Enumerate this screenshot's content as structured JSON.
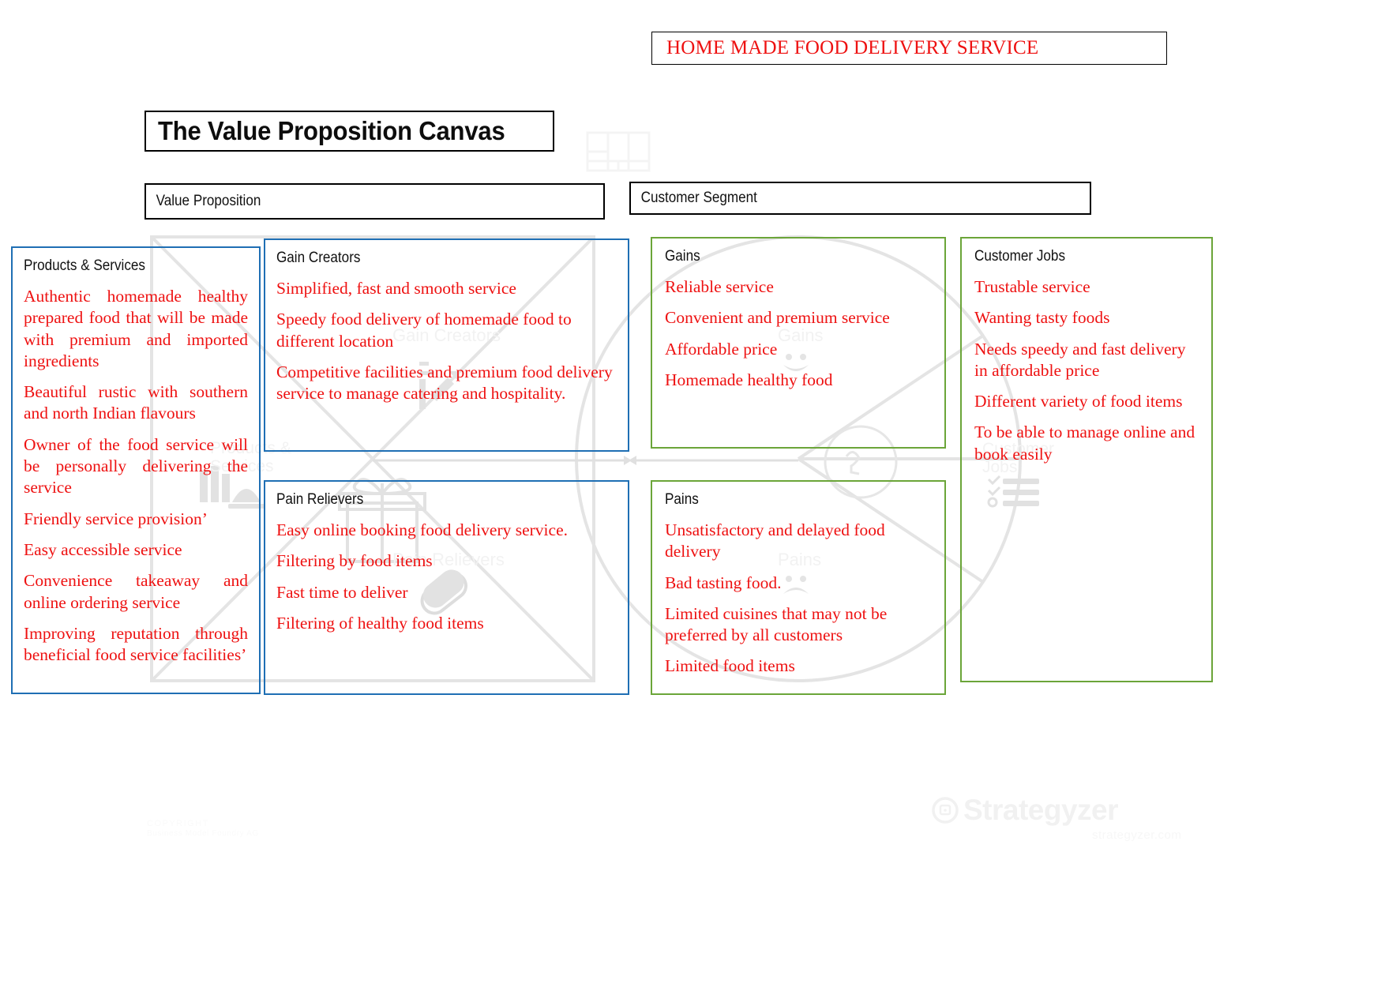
{
  "document": {
    "title": "HOME MADE FOOD DELIVERY SERVICE",
    "canvas_title": "The Value Proposition Canvas"
  },
  "colors": {
    "text_red": "#ee1111",
    "value_prop_border": "#1f6fb4",
    "customer_border": "#6ba539",
    "header_border": "#000000",
    "watermark": "#f2f2f2"
  },
  "sections": {
    "value_proposition": {
      "label": "Value Proposition"
    },
    "customer_segment": {
      "label": "Customer Segment"
    }
  },
  "panels": {
    "products_services": {
      "label": "Products & Services",
      "watermark": "Products & Services",
      "items": [
        "Authentic homemade healthy prepared food that will be made with premium and imported ingredients",
        "Beautiful rustic with southern and north Indian flavours",
        "Owner of the food service will be personally delivering the service",
        "Friendly service provision’",
        "Easy accessible service",
        "Convenience takeaway and online ordering service",
        "Improving reputation through beneficial food service facilities’"
      ]
    },
    "gain_creators": {
      "label": "Gain Creators",
      "watermark": "Gain Creators",
      "items": [
        "Simplified, fast and smooth service",
        "Speedy food delivery of homemade food to different location",
        "Competitive facilities and premium food delivery service to manage catering and hospitality."
      ]
    },
    "pain_relievers": {
      "label": "Pain Relievers",
      "watermark": "Pain Relievers",
      "items": [
        "Easy online booking food delivery service.",
        "Filtering by food items",
        "Fast time to deliver",
        "Filtering of healthy food items"
      ]
    },
    "gains": {
      "label": "Gains",
      "watermark": "Gains",
      "items": [
        "Reliable service",
        "Convenient and premium service",
        "Affordable price",
        "Homemade healthy food"
      ]
    },
    "pains": {
      "label": "Pains",
      "watermark": "Pains",
      "items": [
        "Unsatisfactory and delayed food delivery",
        "Bad tasting food.",
        "Limited cuisines that may not be preferred by all customers",
        "Limited food items"
      ]
    },
    "customer_jobs": {
      "label": "Customer Jobs",
      "watermark": "Customer Jobs",
      "items": [
        "Trustable service",
        "Wanting tasty foods",
        "Needs speedy and fast delivery in affordable price",
        "Different variety of food items",
        "To be able to manage online and book easily"
      ]
    }
  },
  "branding": {
    "logo_text": "Strategyzer",
    "logo_url": "strategyzer.com",
    "copyright_line1": "COPYRIGHT",
    "copyright_line2": "Business Model Foundry AG"
  }
}
